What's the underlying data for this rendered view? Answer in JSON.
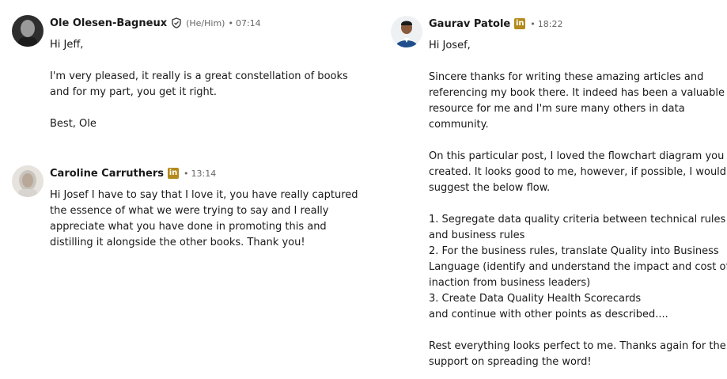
{
  "messages": [
    {
      "author": "Ole Olesen-Bagneux",
      "pronouns": "(He/Him)",
      "time": "07:14",
      "lines": [
        "Hi Jeff,",
        "",
        "I'm very pleased, it really is a great constellation of books",
        "and for my part, you get it right.",
        "",
        "Best, Ole"
      ]
    },
    {
      "author": "Caroline Carruthers",
      "badge": "in",
      "time": "13:14",
      "lines": [
        "Hi Josef I have to say that I love it, you have really captured",
        "the essence of what we were trying to say and I really",
        "appreciate what you have done in promoting this and",
        "distilling it alongside the other books. Thank you!"
      ]
    },
    {
      "author": "Gaurav Patole",
      "badge": "in",
      "time": "18:22",
      "lines": [
        "Hi Josef,",
        "",
        "Sincere thanks for writing these amazing articles and",
        "referencing my book there. It indeed has been a valuable",
        "resource for me and I'm sure many others in data",
        "community.",
        "",
        "On this particular post, I loved the flowchart diagram you",
        "created. It looks good to me, however, if possible, I would",
        "suggest the below flow.",
        "",
        "1. Segregate data quality criteria between technical rules",
        "and business rules",
        "2. For the business rules, translate Quality into Business",
        "Language (identify and understand the impact and cost of",
        "inaction from business leaders)",
        "3. Create Data Quality Health Scorecards",
        "and continue with other points as described....",
        "",
        "Rest everything looks perfect to me. Thanks again for the",
        "support on spreading the word!"
      ]
    }
  ],
  "separator": "•",
  "icons": {
    "verified": "verified-shield-icon",
    "linkedin": "linkedin-badge-icon"
  },
  "colors": {
    "badge": "#b38a1c",
    "meta": "#666666",
    "text": "#191919"
  }
}
